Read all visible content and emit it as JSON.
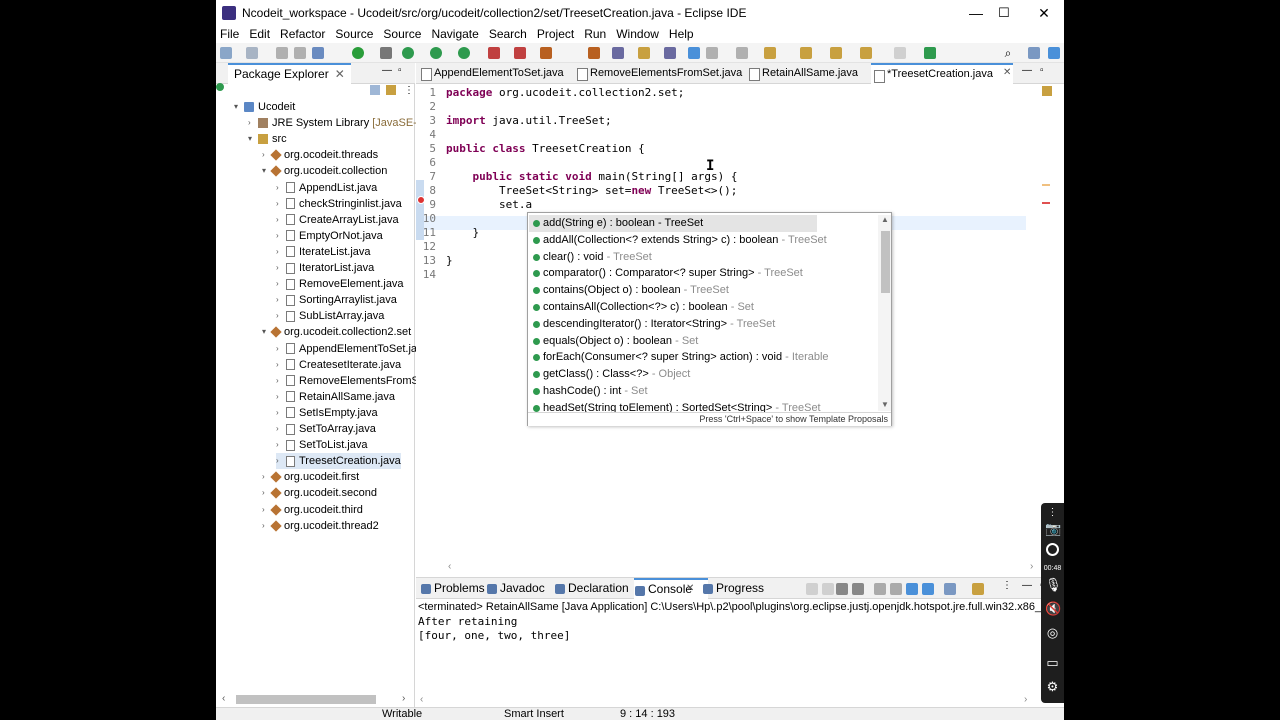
{
  "window": {
    "title": "Ncodeit_workspace - Ucodeit/src/org/ucodeit/collection2/set/TreesetCreation.java - Eclipse IDE",
    "minimize": "—",
    "maximize": "☐",
    "close": "✕"
  },
  "menu": [
    "File",
    "Edit",
    "Refactor",
    "Source",
    "Source",
    "Navigate",
    "Search",
    "Project",
    "Run",
    "Window",
    "Help"
  ],
  "package_explorer": {
    "tab_label": "Package Explorer",
    "tree": [
      {
        "label": "Ucodeit",
        "icon": "project-icon",
        "depth": 0,
        "arrow": "▾"
      },
      {
        "label": "JRE System Library",
        "suffix": "[JavaSE-20",
        "icon": "library-icon",
        "depth": 1,
        "arrow": "›"
      },
      {
        "label": "src",
        "icon": "source-folder-icon",
        "depth": 1,
        "arrow": "▾"
      },
      {
        "label": "org.ocodeit.threads",
        "icon": "package-icon",
        "depth": 2,
        "arrow": "›"
      },
      {
        "label": "org.ucodeit.collection",
        "icon": "package-icon",
        "depth": 2,
        "arrow": "▾"
      },
      {
        "label": "AppendList.java",
        "icon": "java-file-icon",
        "depth": 3,
        "arrow": "›"
      },
      {
        "label": "checkStringinlist.java",
        "icon": "java-file-icon",
        "depth": 3,
        "arrow": "›"
      },
      {
        "label": "CreateArrayList.java",
        "icon": "java-file-icon",
        "depth": 3,
        "arrow": "›"
      },
      {
        "label": "EmptyOrNot.java",
        "icon": "java-file-icon",
        "depth": 3,
        "arrow": "›"
      },
      {
        "label": "IterateList.java",
        "icon": "java-file-icon",
        "depth": 3,
        "arrow": "›"
      },
      {
        "label": "IteratorList.java",
        "icon": "java-file-icon",
        "depth": 3,
        "arrow": "›"
      },
      {
        "label": "RemoveElement.java",
        "icon": "java-file-icon",
        "depth": 3,
        "arrow": "›"
      },
      {
        "label": "SortingArraylist.java",
        "icon": "java-file-icon",
        "depth": 3,
        "arrow": "›"
      },
      {
        "label": "SubListArray.java",
        "icon": "java-file-icon",
        "depth": 3,
        "arrow": "›"
      },
      {
        "label": "org.ucodeit.collection2.set",
        "icon": "package-icon",
        "depth": 2,
        "arrow": "▾"
      },
      {
        "label": "AppendElementToSet.ja",
        "icon": "java-file-icon",
        "depth": 3,
        "arrow": "›"
      },
      {
        "label": "CreatesetIterate.java",
        "icon": "java-file-icon",
        "depth": 3,
        "arrow": "›"
      },
      {
        "label": "RemoveElementsFromS",
        "icon": "java-file-icon",
        "depth": 3,
        "arrow": "›"
      },
      {
        "label": "RetainAllSame.java",
        "icon": "java-file-icon",
        "depth": 3,
        "arrow": "›"
      },
      {
        "label": "SetIsEmpty.java",
        "icon": "java-file-icon",
        "depth": 3,
        "arrow": "›"
      },
      {
        "label": "SetToArray.java",
        "icon": "java-file-icon",
        "depth": 3,
        "arrow": "›"
      },
      {
        "label": "SetToList.java",
        "icon": "java-file-icon",
        "depth": 3,
        "arrow": "›"
      },
      {
        "label": "TreesetCreation.java",
        "icon": "java-file-icon",
        "depth": 3,
        "arrow": "›",
        "selected": true
      },
      {
        "label": "org.ucodeit.first",
        "icon": "package-icon",
        "depth": 2,
        "arrow": "›"
      },
      {
        "label": "org.ucodeit.second",
        "icon": "package-icon",
        "depth": 2,
        "arrow": "›"
      },
      {
        "label": "org.ucodeit.third",
        "icon": "package-icon",
        "depth": 2,
        "arrow": "›"
      },
      {
        "label": "org.ucodeit.thread2",
        "icon": "package-icon",
        "depth": 2,
        "arrow": "›"
      }
    ]
  },
  "editor": {
    "tabs": [
      {
        "label": "AppendElementToSet.java",
        "active": false
      },
      {
        "label": "RemoveElementsFromSet.java",
        "active": false
      },
      {
        "label": "RetainAllSame.java",
        "active": false
      },
      {
        "label": "*TreesetCreation.java",
        "active": true
      }
    ],
    "lines": [
      {
        "n": "1",
        "parts": [
          {
            "t": "package",
            "kw": true
          },
          {
            "t": " org.ucodeit.collection2.set;"
          }
        ]
      },
      {
        "n": "2",
        "parts": []
      },
      {
        "n": "3",
        "parts": [
          {
            "t": "import",
            "kw": true
          },
          {
            "t": " java.util.TreeSet;"
          }
        ]
      },
      {
        "n": "4",
        "parts": []
      },
      {
        "n": "5",
        "parts": [
          {
            "t": "public",
            "kw": true
          },
          {
            "t": " "
          },
          {
            "t": "class",
            "kw": true
          },
          {
            "t": " TreesetCreation {"
          }
        ]
      },
      {
        "n": "6",
        "parts": []
      },
      {
        "n": "7",
        "parts": [
          {
            "t": "    "
          },
          {
            "t": "public",
            "kw": true
          },
          {
            "t": " "
          },
          {
            "t": "static",
            "kw": true
          },
          {
            "t": " "
          },
          {
            "t": "void",
            "kw": true
          },
          {
            "t": " main(String[] args) {"
          }
        ]
      },
      {
        "n": "8",
        "parts": [
          {
            "t": "        TreeSet<String> set="
          },
          {
            "t": "new",
            "kw": true
          },
          {
            "t": " TreeSet<>();"
          }
        ]
      },
      {
        "n": "9",
        "parts": [
          {
            "t": "        set.a"
          }
        ]
      },
      {
        "n": "10",
        "parts": []
      },
      {
        "n": "11",
        "parts": [
          {
            "t": "    }"
          }
        ]
      },
      {
        "n": "12",
        "parts": []
      },
      {
        "n": "13",
        "parts": [
          {
            "t": "}"
          }
        ]
      },
      {
        "n": "14",
        "parts": []
      }
    ]
  },
  "content_assist": {
    "items": [
      {
        "sig": "add(String e) : boolean",
        "from": "- TreeSet",
        "selected": true
      },
      {
        "sig": "addAll(Collection<? extends String> c) : boolean",
        "from": "- TreeSet"
      },
      {
        "sig": "clear() : void",
        "from": "- TreeSet"
      },
      {
        "sig": "comparator() : Comparator<? super String>",
        "from": "- TreeSet"
      },
      {
        "sig": "contains(Object o) : boolean",
        "from": "- TreeSet"
      },
      {
        "sig": "containsAll(Collection<?> c) : boolean",
        "from": "- Set"
      },
      {
        "sig": "descendingIterator() : Iterator<String>",
        "from": "- TreeSet"
      },
      {
        "sig": "equals(Object o) : boolean",
        "from": "- Set"
      },
      {
        "sig": "forEach(Consumer<? super String> action) : void",
        "from": "- Iterable"
      },
      {
        "sig": "getClass() : Class<?>",
        "from": "- Object"
      },
      {
        "sig": "hashCode() : int",
        "from": "- Set"
      },
      {
        "sig": "headSet(String toElement) : SortedSet<String>",
        "from": "- TreeSet"
      }
    ],
    "footer": "Press 'Ctrl+Space' to show Template Proposals"
  },
  "bottom_panel": {
    "tabs": [
      {
        "label": "Problems",
        "active": false
      },
      {
        "label": "Javadoc",
        "active": false
      },
      {
        "label": "Declaration",
        "active": false
      },
      {
        "label": "Console",
        "active": true
      },
      {
        "label": "Progress",
        "active": false
      }
    ],
    "terminated": "<terminated> RetainAllSame [Java Application] C:\\Users\\Hp\\.p2\\pool\\plugins\\org.eclipse.justj.openjdk.hotspot.jre.full.win32.x86_64_20.",
    "output": [
      "After retaining",
      "[four, one, two, three]"
    ]
  },
  "status_bar": {
    "writable": "Writable",
    "insert_mode": "Smart Insert",
    "position": "9 : 14 : 193"
  },
  "camera_panel": {
    "timer": "00:48"
  }
}
